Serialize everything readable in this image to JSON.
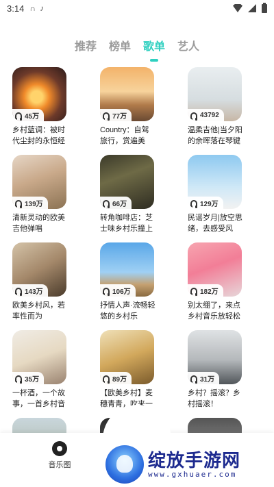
{
  "status_bar": {
    "time": "3:14",
    "icons": [
      "headset-icon",
      "tiktok-icon",
      "wifi-icon",
      "signal-icon",
      "battery-icon"
    ]
  },
  "tabs": [
    {
      "label": "推荐",
      "active": false
    },
    {
      "label": "榜单",
      "active": false
    },
    {
      "label": "歌单",
      "active": true
    },
    {
      "label": "艺人",
      "active": false
    }
  ],
  "accent_color": "#2fd0c0",
  "playlists": [
    {
      "count": "45万",
      "title": "乡村蓝调：被时代尘封的永恒经典"
    },
    {
      "count": "77万",
      "title": "Country：自驾旅行，赏遍美景，..."
    },
    {
      "count": "43792",
      "title": "温柔吉他|当夕阳的余晖落在琴键上"
    },
    {
      "count": "139万",
      "title": "清新灵动的欧美吉他弹唱"
    },
    {
      "count": "66万",
      "title": "转角咖啡店：芝士味乡村乐撞上柠..."
    },
    {
      "count": "129万",
      "title": "民谣岁月|放空思绪，去感受风"
    },
    {
      "count": "143万",
      "title": "欧美乡村风，若率性而为"
    },
    {
      "count": "106万",
      "title": "抒情人声·流畅轻悠的乡村乐"
    },
    {
      "count": "182万",
      "title": "别太绷了，来点乡村音乐放轻松"
    },
    {
      "count": "35万",
      "title": "一杯酒，一个故事，一首乡村音乐"
    },
    {
      "count": "89万",
      "title": "【欧美乡村】麦穗青青，吹来一阵..."
    },
    {
      "count": "31万",
      "title": "乡村？摇滚？乡村摇滚！"
    }
  ],
  "bottom_nav": {
    "label": "音乐图"
  },
  "watermark": {
    "title": "绽放手游网",
    "subtitle": "www.gxhuaer.com"
  }
}
